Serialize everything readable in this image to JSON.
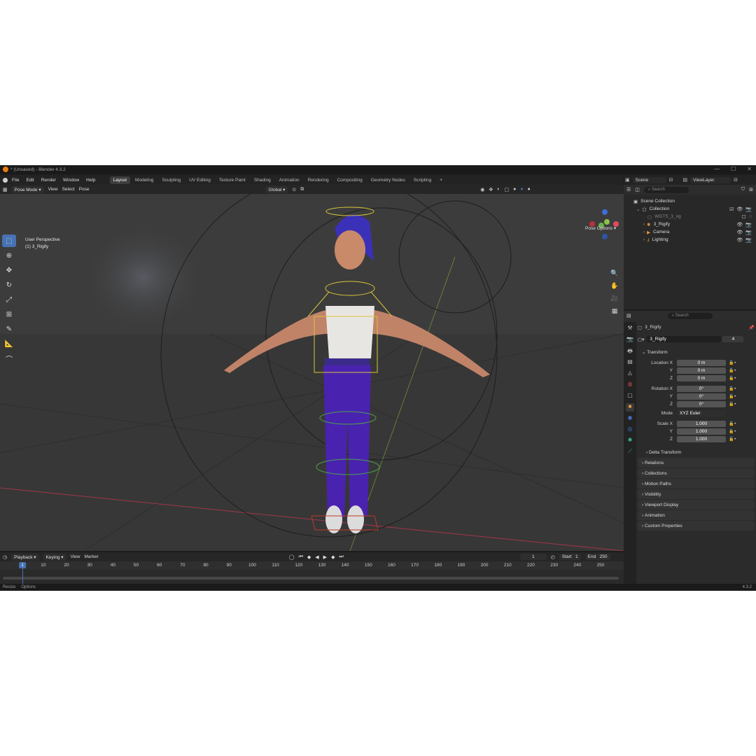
{
  "window": {
    "title": "* (Unsaved) - Blender 4.3.2",
    "controls": [
      "—",
      "☐",
      "✕"
    ]
  },
  "menu": [
    "File",
    "Edit",
    "Render",
    "Window",
    "Help"
  ],
  "workspaces": [
    "Layout",
    "Modeling",
    "Sculpting",
    "UV Editing",
    "Texture Paint",
    "Shading",
    "Animation",
    "Rendering",
    "Compositing",
    "Geometry Nodes",
    "Scripting"
  ],
  "active_workspace": "Layout",
  "scene": {
    "name": "Scene",
    "view_layer": "ViewLayer"
  },
  "viewport": {
    "mode": "Pose Mode",
    "menus": [
      "View",
      "Select",
      "Pose"
    ],
    "orientation": "Global",
    "overlay_text_1": "User Perspective",
    "overlay_text_2": "(1) 3_Rigify",
    "pose_options": "Pose Options",
    "gizmo": {
      "x": "X",
      "y": "Y",
      "z": "Z"
    }
  },
  "timeline": {
    "menus": [
      "Playback",
      "Keying",
      "View",
      "Marker"
    ],
    "current_frame": "1",
    "start_label": "Start",
    "start": "1",
    "end_label": "End",
    "end": "250",
    "ticks": [
      "1",
      "10",
      "20",
      "30",
      "40",
      "50",
      "60",
      "70",
      "80",
      "90",
      "100",
      "110",
      "120",
      "130",
      "140",
      "150",
      "160",
      "170",
      "180",
      "190",
      "200",
      "210",
      "220",
      "230",
      "240",
      "250"
    ]
  },
  "outliner": {
    "search_placeholder": "Search",
    "rows": [
      {
        "label": "Scene Collection"
      },
      {
        "label": "Collection"
      },
      {
        "label": "WGTS_3_rig"
      },
      {
        "label": "3_Rigify"
      },
      {
        "label": "Camera"
      },
      {
        "label": "Lighting"
      }
    ]
  },
  "properties": {
    "search_placeholder": "Search",
    "object_name": "3_Rigify",
    "data_name": "3_Rigify",
    "users": "4",
    "transform_label": "Transform",
    "location": {
      "label": "Location X",
      "x": "0 m",
      "y": "0 m",
      "z": "0 m"
    },
    "rotation": {
      "label": "Rotation X",
      "x": "0°",
      "y": "0°",
      "z": "0°"
    },
    "mode": {
      "label": "Mode",
      "value": "XYZ Euler"
    },
    "scale": {
      "label": "Scale X",
      "x": "1.000",
      "y": "1.000",
      "z": "1.000"
    },
    "axis_y": "Y",
    "axis_z": "Z",
    "sections": [
      "Delta Transform",
      "Relations",
      "Collections",
      "Motion Paths",
      "Visibility",
      "Viewport Display",
      "Animation",
      "Custom Properties"
    ]
  },
  "status": {
    "left": [
      "Resize",
      "Options"
    ],
    "version": "4.3.2"
  }
}
